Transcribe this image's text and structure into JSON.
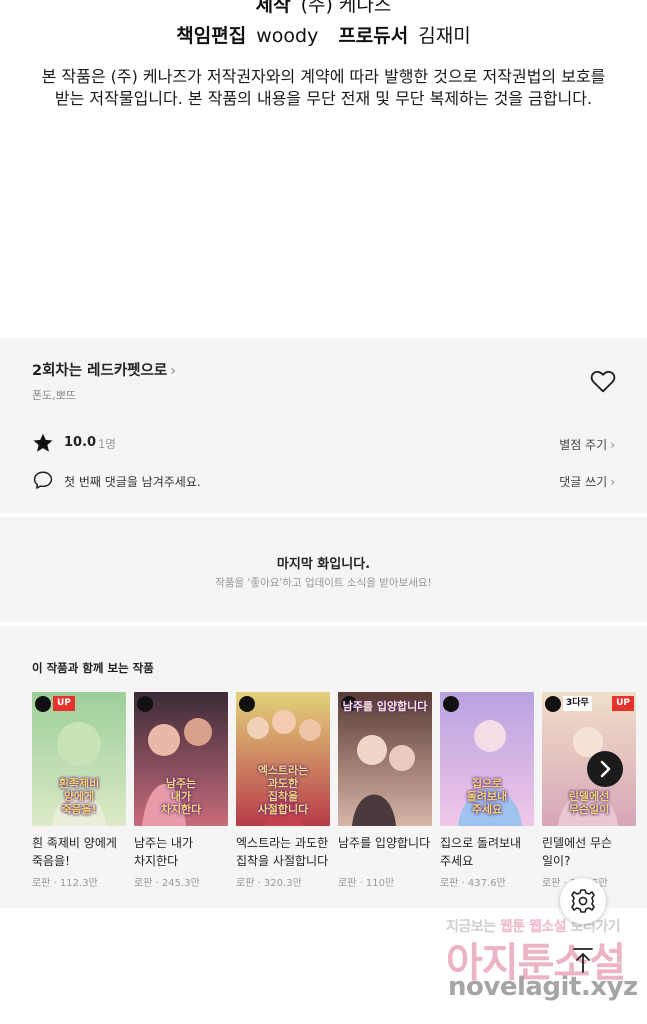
{
  "credits": {
    "line1": {
      "label": "제작",
      "value": "(주) 케나즈"
    },
    "line2": {
      "label1": "책임편집",
      "value1": "woody",
      "label2": "프로듀서",
      "value2": "김재미"
    },
    "copyright_line1": "본 작품은 (주) 케나즈가 저작권자와의 계약에 따라 발행한 것으로 저작권법의 보호를",
    "copyright_line2": "받는 저작물입니다. 본 작품의 내용을 무단 전재 및 무단 복제하는 것을 금합니다."
  },
  "episode": {
    "title": "2회차는 레드카펫으로",
    "chevron": "›",
    "author": "폰도,뽀뜨",
    "rating": "10.0",
    "rating_count": "1명",
    "rate_action": "별점 주기",
    "comment_placeholder": "첫 번째 댓글을 남겨주세요.",
    "comment_action": "댓글 쓰기"
  },
  "last_episode": {
    "title": "마지막 화입니다.",
    "subtitle": "작품을 '좋아요'하고 업데이트 소식을 받아보세요!"
  },
  "recommendations": {
    "section_title": "이 작품과 함께 보는 작품",
    "items": [
      {
        "title": "흰 족제비 양에게 죽음을!",
        "meta": "로판 · 112.3만",
        "badge": "UP",
        "cover_text": "흰족제비\n양에게\n죽음을!",
        "color1": "#9ccf9a",
        "color2": "#dce9c8"
      },
      {
        "title": "남주는 내가 차지한다",
        "meta": "로판 · 245.3만",
        "badge": "",
        "cover_text": "남주는\n내가\n차지한다",
        "color1": "#3b2b38",
        "color2": "#c96b7a"
      },
      {
        "title": "엑스트라는 과도한 집착을 사절합니다",
        "meta": "로판 · 320.3만",
        "badge": "",
        "cover_text": "엑스트라는\n과도한\n집착을\n사절합니다",
        "color1": "#e3d27a",
        "color2": "#b83c4a"
      },
      {
        "title": "남주를 입양합니다",
        "meta": "로판 · 110만",
        "badge": "",
        "cover_text": "남주를 입양합니다",
        "color1": "#5a3b34",
        "color2": "#d7b6a8"
      },
      {
        "title": "집으로 돌려보내 주세요",
        "meta": "로판 · 437.6만",
        "badge": "",
        "cover_text": "집으로\n돌려보내\n주세요",
        "color1": "#b9a2e0",
        "color2": "#f0c7e8"
      },
      {
        "title": "린델에선 무슨 일이?",
        "meta": "로판 · 153.5만",
        "badge": "UP",
        "wait": "3다무",
        "cover_text": "린델에선\n무슨일이",
        "color1": "#f0dfc8",
        "color2": "#d7a6b8"
      }
    ]
  },
  "watermark": {
    "top_plain1": "지금보는 ",
    "top_highlight1": "웹툰",
    "top_plain2": " ",
    "top_highlight2": "웹소설",
    "top_plain3": " 보러가기",
    "middle": "아지툰소설",
    "bottom": "novelagit.xyz"
  },
  "colors": {
    "background": "#ffffff",
    "panel": "#f5f5f5",
    "badge_up": "#e8332d",
    "text": "#222222",
    "muted": "#999999"
  },
  "icons": [
    "heart-icon",
    "star-icon",
    "comment-icon",
    "chevron-right-icon",
    "clock-icon",
    "settings-icon",
    "arrow-up-icon"
  ]
}
